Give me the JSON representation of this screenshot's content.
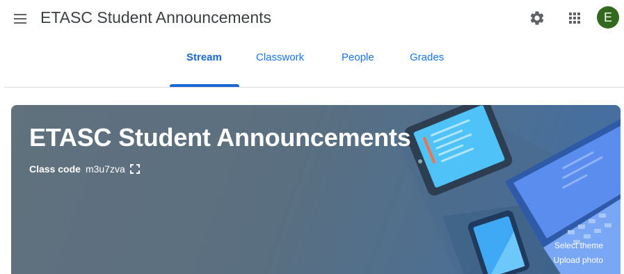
{
  "header": {
    "title": "ETASC Student Announcements",
    "avatar_initial": "E",
    "avatar_color": "#33691e",
    "icons": {
      "menu": "hamburger-menu-icon",
      "settings": "gear-icon",
      "apps": "apps-grid-icon"
    }
  },
  "tabs": [
    {
      "label": "Stream",
      "active": true
    },
    {
      "label": "Classwork",
      "active": false
    },
    {
      "label": "People",
      "active": false
    },
    {
      "label": "Grades",
      "active": false
    }
  ],
  "banner": {
    "title": "ETASC Student Announcements",
    "class_code_label": "Class code",
    "class_code": "m3u7zva",
    "select_theme": "Select theme",
    "upload_photo": "Upload photo"
  },
  "colors": {
    "accent": "#1967d2",
    "banner": "#5a6f80"
  }
}
